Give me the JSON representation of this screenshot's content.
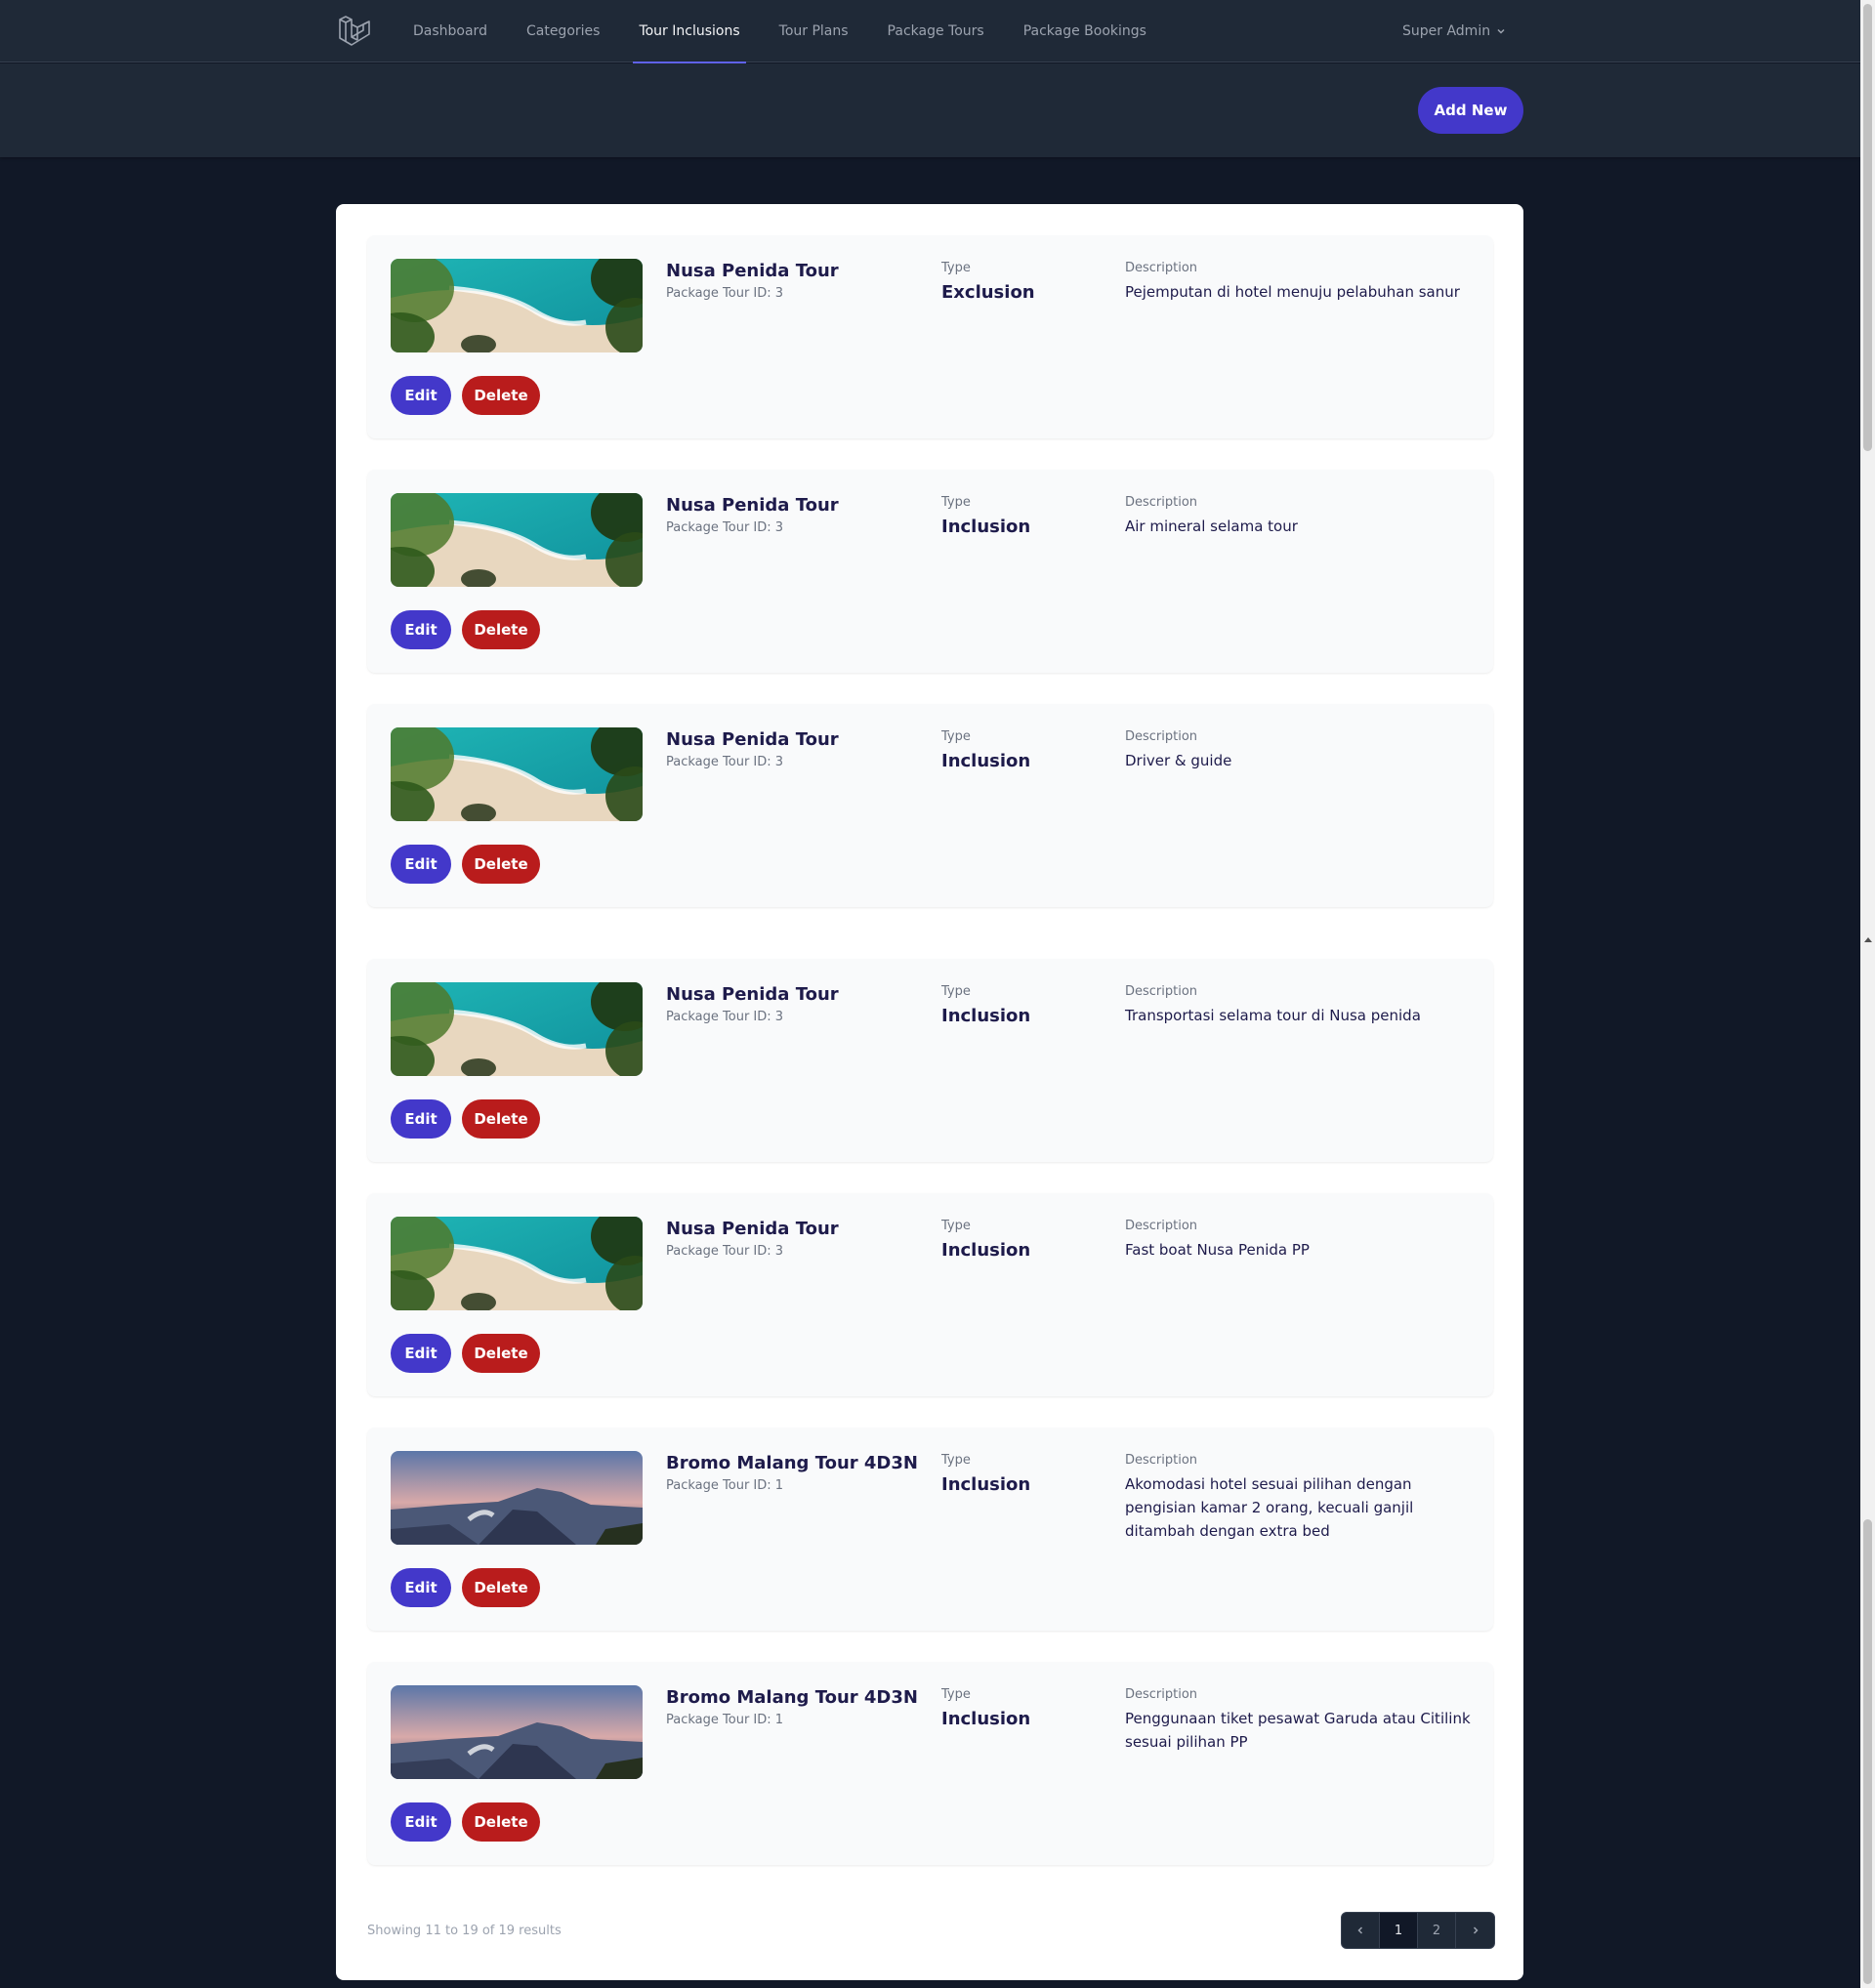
{
  "nav": {
    "links": [
      {
        "label": "Dashboard",
        "active": false
      },
      {
        "label": "Categories",
        "active": false
      },
      {
        "label": "Tour Inclusions",
        "active": true
      },
      {
        "label": "Tour Plans",
        "active": false
      },
      {
        "label": "Package Tours",
        "active": false
      },
      {
        "label": "Package Bookings",
        "active": false
      }
    ],
    "user": "Super Admin"
  },
  "header": {
    "add_new_label": "Add New"
  },
  "labels": {
    "type": "Type",
    "description": "Description",
    "edit": "Edit",
    "delete": "Delete"
  },
  "items": [
    {
      "name": "Nusa Penida Tour",
      "package_id": "Package Tour ID: 3",
      "type": "Exclusion",
      "description": "Pejemputan di hotel menuju pelabuhan sanur",
      "image": "beach"
    },
    {
      "name": "Nusa Penida Tour",
      "package_id": "Package Tour ID: 3",
      "type": "Inclusion",
      "description": "Air mineral selama tour",
      "image": "beach"
    },
    {
      "name": "Nusa Penida Tour",
      "package_id": "Package Tour ID: 3",
      "type": "Inclusion",
      "description": "Driver & guide",
      "image": "beach"
    },
    {
      "name": "Nusa Penida Tour",
      "package_id": "Package Tour ID: 3",
      "type": "Inclusion",
      "description": "Transportasi selama tour di Nusa penida",
      "image": "beach"
    },
    {
      "name": "Nusa Penida Tour",
      "package_id": "Package Tour ID: 3",
      "type": "Inclusion",
      "description": "Fast boat Nusa Penida PP",
      "image": "beach"
    },
    {
      "name": "Bromo Malang Tour 4D3N",
      "package_id": "Package Tour ID: 1",
      "type": "Inclusion",
      "description": "Akomodasi hotel sesuai pilihan dengan pengisian kamar 2 orang, kecuali ganjil ditambah dengan extra bed",
      "image": "mountain"
    },
    {
      "name": "Bromo Malang Tour 4D3N",
      "package_id": "Package Tour ID: 1",
      "type": "Inclusion",
      "description": "Penggunaan tiket pesawat Garuda atau Citilink sesuai pilihan PP",
      "image": "mountain"
    }
  ],
  "pagination": {
    "summary": "Showing 11 to 19 of 19 results",
    "pages": [
      "1",
      "2"
    ],
    "current": "1"
  }
}
